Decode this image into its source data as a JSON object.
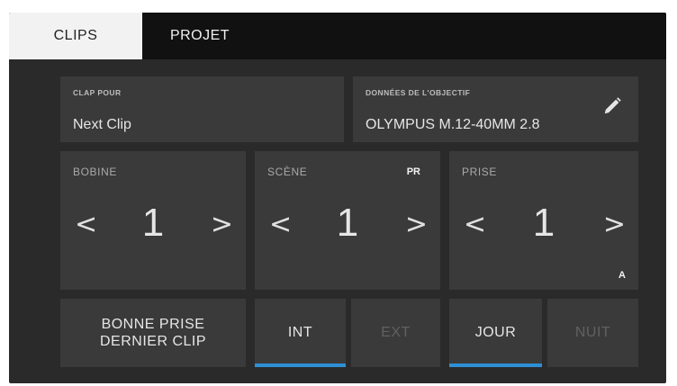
{
  "tabs": [
    {
      "label": "CLIPS",
      "active": true
    },
    {
      "label": "PROJET",
      "active": false
    }
  ],
  "clap": {
    "label": "CLAP POUR",
    "value": "Next Clip"
  },
  "lens": {
    "label": "DONNÉES DE L'OBJECTIF",
    "value": "OLYMPUS M.12-40MM 2.8",
    "icon": "pencil-icon"
  },
  "reel": {
    "label": "BOBINE",
    "value": "1",
    "prev": "<",
    "next": ">"
  },
  "scene": {
    "label": "SCÈNE",
    "badge": "PR",
    "value": "1",
    "prev": "<",
    "next": ">"
  },
  "take": {
    "label": "PRISE",
    "badge": "A",
    "value": "1",
    "prev": "<",
    "next": ">"
  },
  "good_take": {
    "line1": "BONNE PRISE",
    "line2": "DERNIER CLIP"
  },
  "int_ext": {
    "int": "INT",
    "ext": "EXT",
    "selected": "INT"
  },
  "day_night": {
    "day": "JOUR",
    "night": "NUIT",
    "selected": "JOUR"
  },
  "colors": {
    "accent": "#2e8fd6",
    "panel": "#3a3a3a",
    "background": "#2a2a2a",
    "tabbar": "#111111",
    "active_tab": "#f2f2f2"
  }
}
